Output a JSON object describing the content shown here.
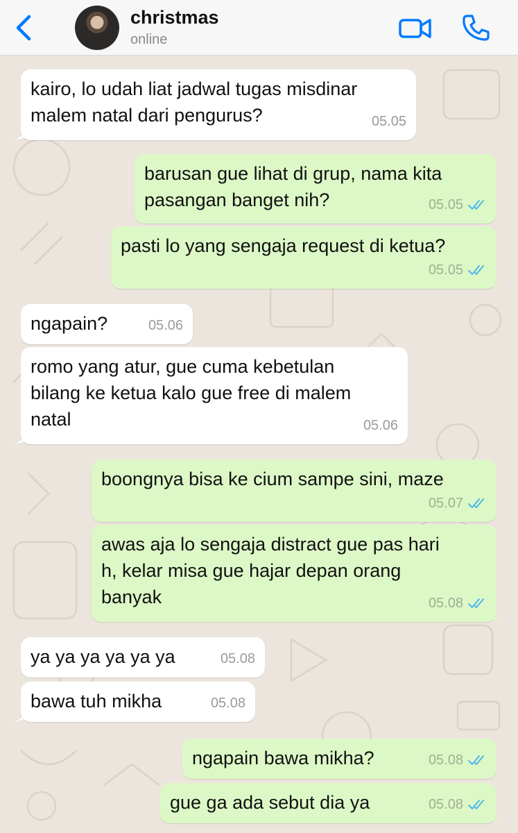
{
  "header": {
    "contact_name": "christmas",
    "status": "online"
  },
  "colors": {
    "accent": "#007aff",
    "incoming_bubble": "#ffffff",
    "outgoing_bubble": "#dcf8c6",
    "chat_background": "#ece5dd",
    "read_ticks": "#4fb6ec"
  },
  "icons": {
    "back": "chevron-left-icon",
    "video": "video-camera-icon",
    "call": "phone-icon",
    "read": "double-check-icon"
  },
  "messages": [
    {
      "dir": "in",
      "text": "kairo, lo udah liat jadwal tugas misdinar\nmalem natal dari pengurus?",
      "time": "05.05"
    },
    {
      "dir": "out",
      "text": "barusan gue lihat di grup, nama kita\npasangan banget nih?",
      "time": "05.05",
      "read": true
    },
    {
      "dir": "out",
      "text": "pasti lo yang sengaja request di ketua?",
      "time": "05.05",
      "read": true
    },
    {
      "dir": "in",
      "text": "ngapain?",
      "time": "05.06"
    },
    {
      "dir": "in",
      "text": "romo yang atur, gue cuma kebetulan\nbilang ke ketua kalo gue free di malem\nnatal",
      "time": "05.06"
    },
    {
      "dir": "out",
      "text": "boongnya bisa ke cium sampe sini, maze",
      "time": "05.07",
      "read": true
    },
    {
      "dir": "out",
      "text": "awas aja lo sengaja distract gue pas hari\nh, kelar misa gue hajar depan orang\nbanyak",
      "time": "05.08",
      "read": true
    },
    {
      "dir": "in",
      "text": "ya ya ya ya ya ya",
      "time": "05.08"
    },
    {
      "dir": "in",
      "text": "bawa tuh mikha",
      "time": "05.08"
    },
    {
      "dir": "out",
      "text": "ngapain bawa mikha?",
      "time": "05.08",
      "read": true
    },
    {
      "dir": "out",
      "text": "gue ga ada sebut dia ya",
      "time": "05.08",
      "read": true
    }
  ]
}
